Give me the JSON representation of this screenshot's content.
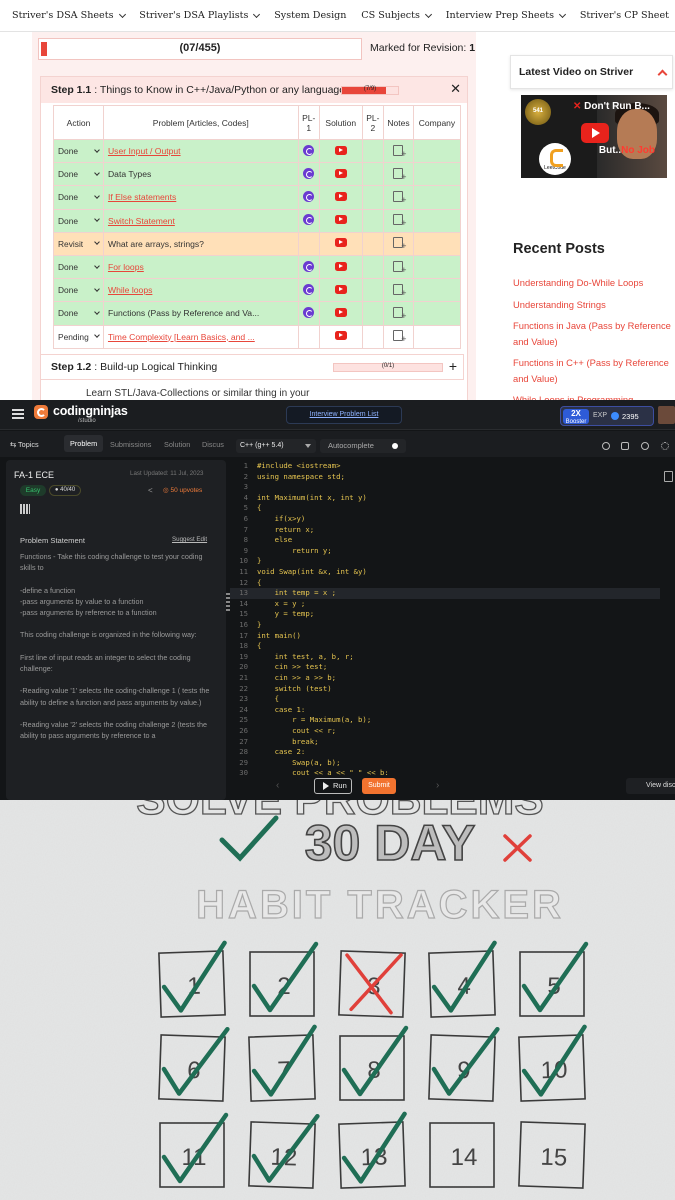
{
  "striver": {
    "nav": [
      "Striver's DSA Sheets",
      "Striver's DSA Playlists",
      "System Design",
      "CS Subjects",
      "Interview Prep Sheets",
      "Striver's CP Sheet"
    ],
    "progress_text": "(07/455)",
    "progress_fraction": 0.0154,
    "marked_label": "Marked for Revision:",
    "marked_count": "1",
    "step1": {
      "label": "Step 1.1",
      "title": ": Things to Know in C++/Java/Python or any language",
      "progress_text": "(7/9)",
      "progress_fraction": 0.78
    },
    "table_headers": [
      "Action",
      "Problem [Articles, Codes]",
      "PL-\n1",
      "Solution",
      "PL-\n2",
      "Notes",
      "Company"
    ],
    "rows": [
      {
        "status": "Done",
        "problem": "User Input / Output",
        "link": true,
        "pl1": true
      },
      {
        "status": "Done",
        "problem": "Data Types",
        "link": false,
        "pl1": true
      },
      {
        "status": "Done",
        "problem": "If Else statements",
        "link": true,
        "pl1": true
      },
      {
        "status": "Done",
        "problem": "Switch Statement",
        "link": true,
        "pl1": true
      },
      {
        "status": "Revisit",
        "problem": "What are arrays, strings?",
        "link": false,
        "pl1": false
      },
      {
        "status": "Done",
        "problem": "For loops",
        "link": true,
        "pl1": true
      },
      {
        "status": "Done",
        "problem": "While loops",
        "link": true,
        "pl1": true
      },
      {
        "status": "Done",
        "problem": "Functions (Pass by Reference and Va...",
        "link": false,
        "pl1": true
      },
      {
        "status": "Pending",
        "problem": "Time Complexity [Learn Basics, and ...",
        "link": true,
        "pl1": false
      }
    ],
    "step2": {
      "label": "Step 1.2",
      "title": ": Build-up Logical Thinking",
      "progress_text": "(0/1)",
      "progress_fraction": 0
    },
    "step3_text": "Learn STL/Java-Collections or similar thing in your",
    "latest_video_title": "Latest Video on Striver",
    "thumb": {
      "headline": "Don't Run B...",
      "sub1": "But..",
      "sub2": "No Job",
      "badge": "LeetCode",
      "num": "541"
    },
    "recent_posts_title": "Recent Posts",
    "recent_posts": [
      "Understanding Do-While Loops",
      "Understanding Strings",
      "Functions in Java (Pass by Reference and Value)",
      "Functions in C++ (Pass by Reference and Value)",
      "While Loops in Programming"
    ]
  },
  "ninjas": {
    "brand": "codingninjas",
    "studio": "/studio",
    "interview_list": "Interview Problem List",
    "booster": {
      "mult": "2X",
      "label": "Booster",
      "exp_label": "EXP",
      "exp": "2395"
    },
    "tabs": [
      "Topics",
      "Problem",
      "Submissions",
      "Solution",
      "Discus"
    ],
    "problem_title": "FA-1 ECE",
    "last_updated": "Last Updated: 11 Jul, 2023",
    "difficulty": "Easy",
    "points": "40/40",
    "upvotes": "50 upvotes",
    "ps_heading": "Problem Statement",
    "suggest_edit": "Suggest Edit",
    "description": "Functions - Take this coding challenge to test your coding skills to\n\n-define a function\n-pass arguments by value to a function\n-pass arguments by reference to a function\n\nThis coding challenge is organized in the following way:\n\nFirst line of input reads an integer to select the coding challenge:\n\n-Reading value '1' selects the coding-challenge 1 ( tests the ability to define a function and pass arguments by value.)\n\n-Reading value '2' selects the coding challenge 2 (tests the ability to pass arguments by reference to a",
    "language": "C++ (g++ 5.4)",
    "autocomplete": "Autocomplete",
    "code_lines": [
      "#include <iostream>",
      "using namespace std;",
      "",
      "int Maximum(int x, int y)",
      "{",
      "    if(x>y)",
      "    return x;",
      "    else",
      "        return y;",
      "}",
      "void Swap(int &x, int &y)",
      "{",
      "    int temp = x ;",
      "    x = y ;",
      "    y = temp;",
      "}",
      "int main()",
      "{",
      "    int test, a, b, r;",
      "    cin >> test;",
      "    cin >> a >> b;",
      "    switch (test)",
      "    {",
      "    case 1:",
      "        r = Maximum(a, b);",
      "        cout << r;",
      "        break;",
      "    case 2:",
      "        Swap(a, b);",
      "        cout << a << \" \" << b;"
    ],
    "highlight_line": 13,
    "run_label": "Run",
    "submit_label": "Submit",
    "view_label": "View disc"
  },
  "habit": {
    "top_partial": "SOLVE PROBLEMS",
    "title": "30 DAY",
    "subtitle": "HABIT TRACKER",
    "days": [
      "1",
      "2",
      "3",
      "4",
      "5",
      "6",
      "7",
      "8",
      "9",
      "10",
      "11",
      "12",
      "13",
      "14",
      "15"
    ],
    "checked": [
      true,
      true,
      false,
      true,
      true,
      true,
      true,
      true,
      true,
      true,
      true,
      true,
      true,
      false,
      false
    ],
    "crossed": [
      false,
      false,
      true,
      false,
      false,
      false,
      false,
      false,
      false,
      false,
      false,
      false,
      false,
      false,
      false
    ],
    "ink_green": "#1f6e55",
    "ink_red": "#e0403a"
  },
  "colors": {
    "striver_accent": "#e8463a",
    "ninjas_orange": "#f2732f"
  }
}
